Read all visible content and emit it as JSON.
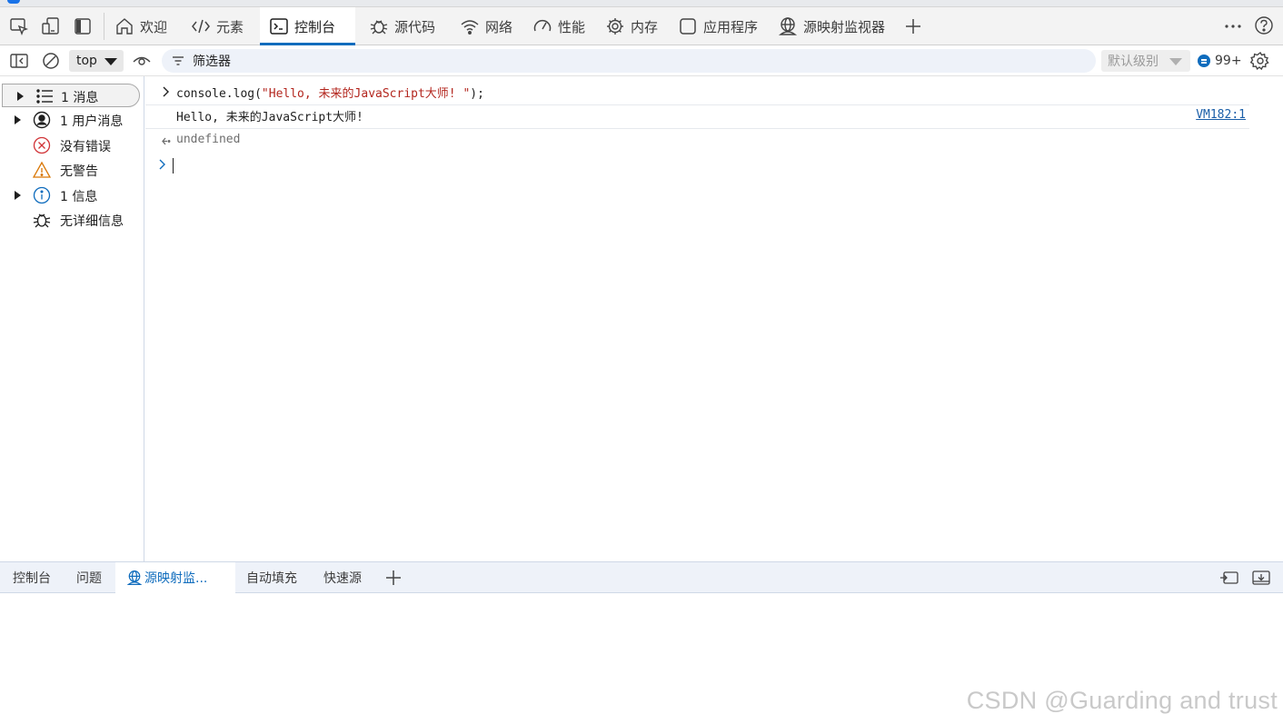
{
  "devtools_tabs": [
    {
      "label": "欢迎",
      "icon": "home-icon",
      "active": false
    },
    {
      "label": "元素",
      "icon": "code-tags-icon",
      "active": false
    },
    {
      "label": "控制台",
      "icon": "console-icon",
      "active": true
    },
    {
      "label": "源代码",
      "icon": "bug-icon",
      "active": false
    },
    {
      "label": "网络",
      "icon": "wifi-icon",
      "active": false
    },
    {
      "label": "性能",
      "icon": "gauge-icon",
      "active": false
    },
    {
      "label": "内存",
      "icon": "chip-icon",
      "active": false
    },
    {
      "label": "应用程序",
      "icon": "app-window-icon",
      "active": false
    },
    {
      "label": "源映射监视器",
      "icon": "globe-person-icon",
      "active": false
    }
  ],
  "toolbar": {
    "context": "top",
    "filter_placeholder": "筛选器",
    "level": "默认级别",
    "issues_count": "99+"
  },
  "sidebar": {
    "items": [
      {
        "label": "1 消息",
        "icon": "list-icon",
        "expandable": true,
        "selected": true
      },
      {
        "label": "1 用户消息",
        "icon": "user-circle-icon",
        "expandable": true,
        "selected": false
      },
      {
        "label": "没有错误",
        "icon": "error-circle-icon",
        "expandable": false,
        "selected": false
      },
      {
        "label": "无警告",
        "icon": "warning-triangle-icon",
        "expandable": false,
        "selected": false
      },
      {
        "label": "1 信息",
        "icon": "info-circle-icon",
        "expandable": true,
        "selected": false
      },
      {
        "label": "无详细信息",
        "icon": "bug-icon",
        "expandable": false,
        "selected": false
      }
    ]
  },
  "console": {
    "input_prefix": "console.log(",
    "input_string": "\"Hello, 未来的JavaScript大师! \"",
    "input_suffix": ");",
    "output_text": "Hello, 未来的JavaScript大师!",
    "output_source": "VM182:1",
    "result_text": "undefined"
  },
  "drawer": {
    "tabs": [
      {
        "label": "控制台",
        "active": false
      },
      {
        "label": "问题",
        "active": false
      },
      {
        "label": "源映射监...",
        "active": true
      },
      {
        "label": "自动填充",
        "active": false
      },
      {
        "label": "快速源",
        "active": false
      }
    ]
  },
  "watermark": "CSDN @Guarding and trust",
  "colors": {
    "accent": "#0f6cbd",
    "string": "#b3261e",
    "link": "#1a5ea8",
    "error": "#d13438",
    "warning": "#d97706",
    "info": "#0f6cbd"
  }
}
